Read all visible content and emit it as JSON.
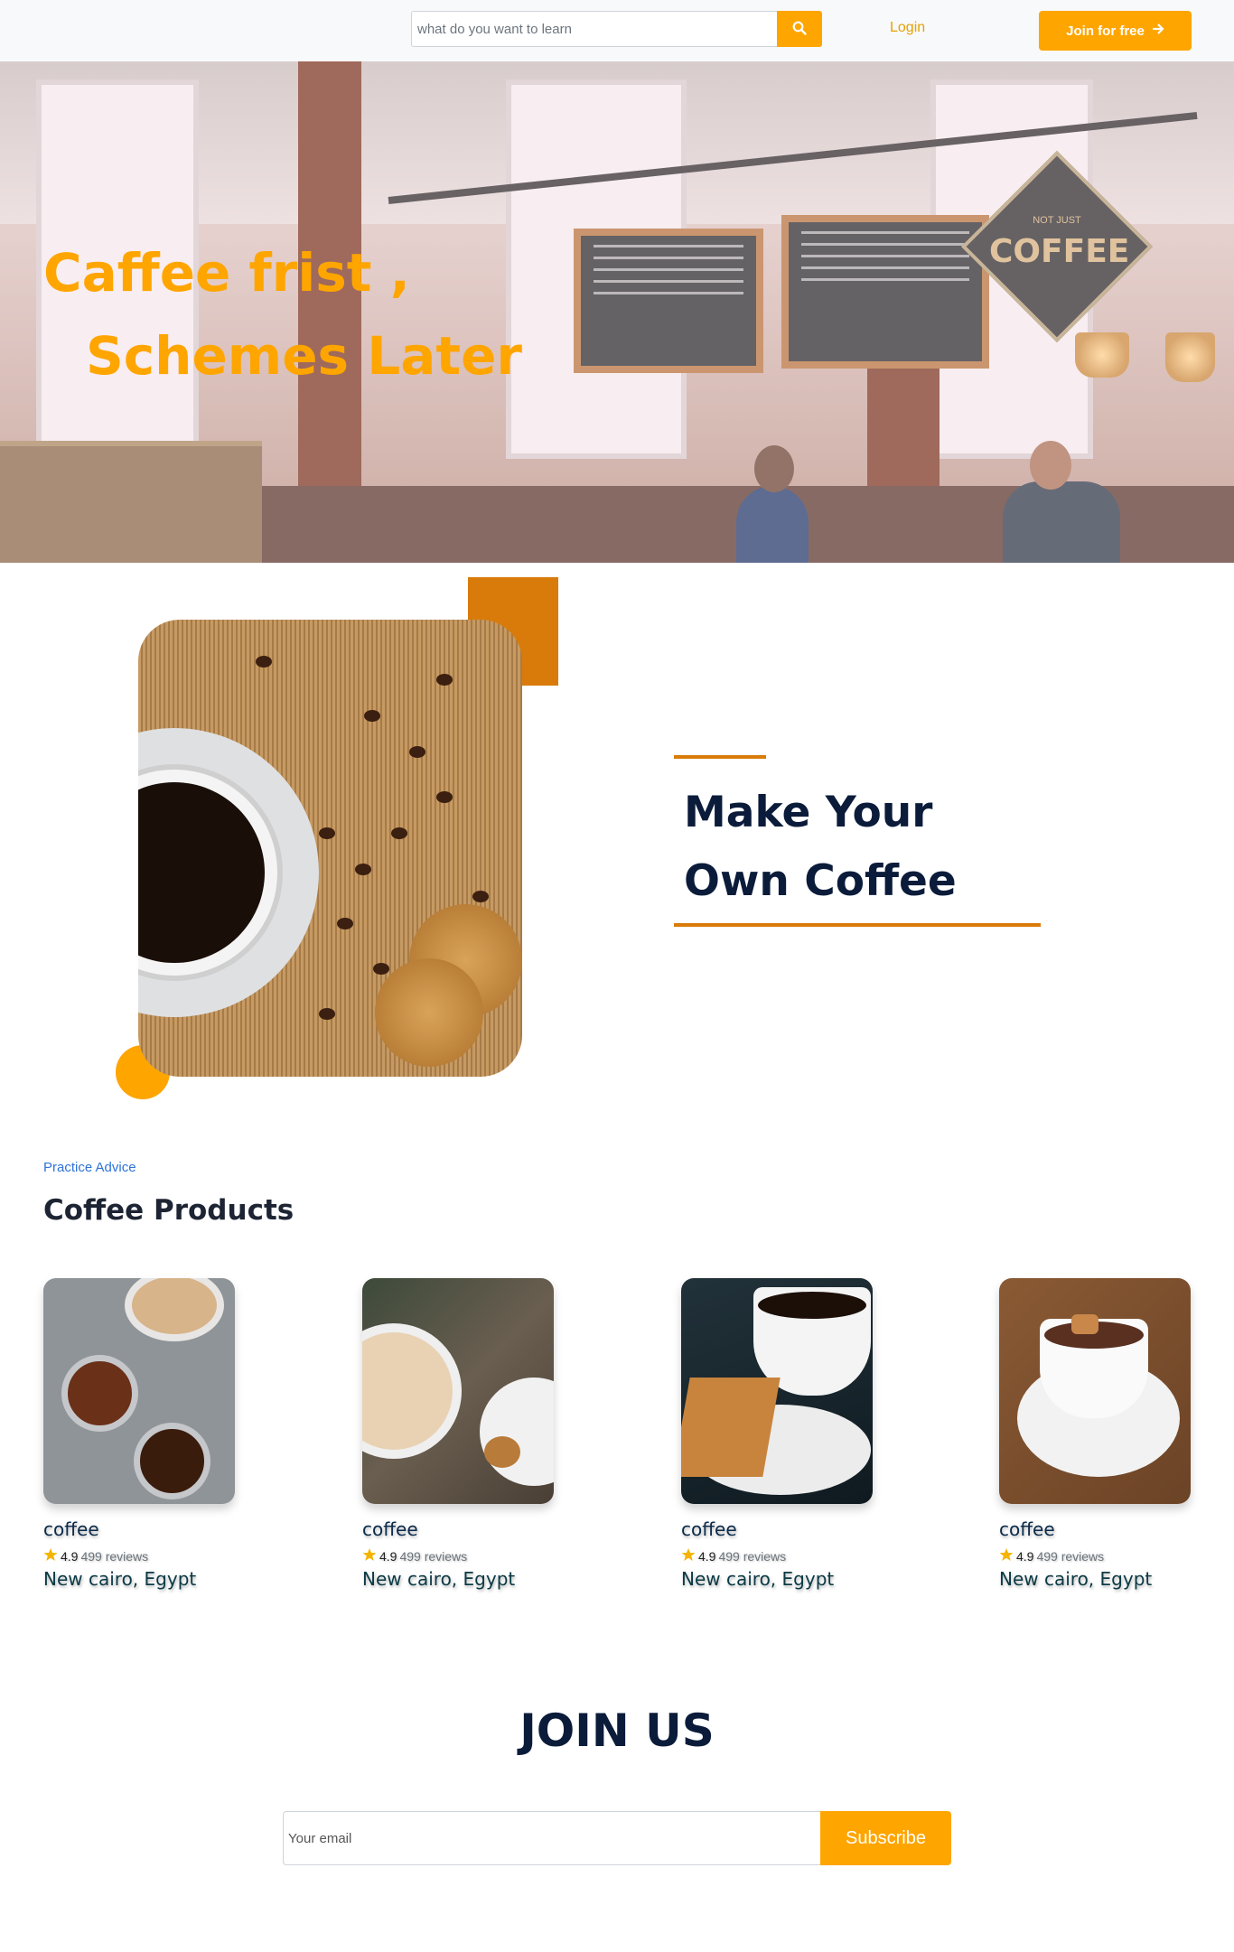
{
  "navbar": {
    "search_placeholder": "what do you want to learn",
    "search_icon": "search-icon",
    "login_label": "Login",
    "join_label": "Join for free",
    "join_icon": "arrow-right-icon"
  },
  "hero": {
    "title_line1": "Caffee frist ,",
    "title_line2": "Schemes Later",
    "sign_top": "NOT JUST",
    "sign_main": "COFFEE"
  },
  "about": {
    "title": "Make Your Own Coffee"
  },
  "products": {
    "eyebrow": "Practice Advice",
    "title": "Coffee Products",
    "items": [
      {
        "name": "coffee",
        "rating": "4.9",
        "reviews": "499 reviews",
        "location": "New cairo, Egypt"
      },
      {
        "name": "coffee",
        "rating": "4.9",
        "reviews": "499 reviews",
        "location": "New cairo, Egypt"
      },
      {
        "name": "coffee",
        "rating": "4.9",
        "reviews": "499 reviews",
        "location": "New cairo, Egypt"
      },
      {
        "name": "coffee",
        "rating": "4.9",
        "reviews": "499 reviews",
        "location": "New cairo, Egypt"
      }
    ]
  },
  "join": {
    "title": "JOIN US",
    "email_placeholder": "Your email",
    "subscribe_label": "Subscribe"
  },
  "colors": {
    "accent": "#ffa500",
    "accent_dark": "#d97b0b",
    "navy": "#0b1b3a",
    "link_blue": "#2f73d6"
  }
}
